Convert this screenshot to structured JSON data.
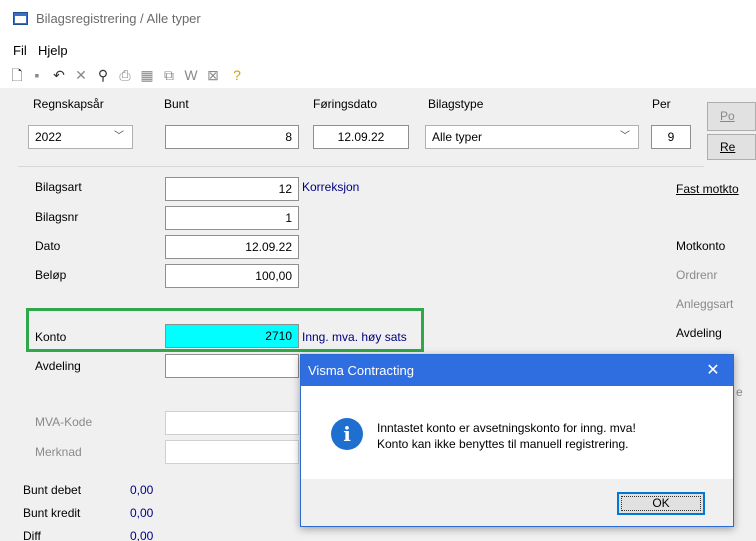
{
  "window": {
    "title": "Bilagsregistrering / Alle typer"
  },
  "menu": [
    "Fil",
    "Hjelp"
  ],
  "toolbar": {
    "icons": [
      "new-document-icon",
      "save-icon",
      "undo-icon",
      "delete-icon",
      "find-icon",
      "print-icon",
      "calculator-icon",
      "copy-icon",
      "word-icon",
      "excel-icon",
      "help-icon"
    ]
  },
  "header": {
    "regnskapsar_label": "Regnskapsår",
    "regnskapsar_value": "2022",
    "bunt_label": "Bunt",
    "bunt_value": "8",
    "foringsdato_label": "Føringsdato",
    "foringsdato_value": "12.09.22",
    "bilagstype_label": "Bilagstype",
    "bilagstype_value": "Alle typer",
    "per_label": "Per",
    "per_value": "9",
    "btn_top": "Po",
    "btn_bottom": "Re"
  },
  "form": {
    "bilagsart_label": "Bilagsart",
    "bilagsart_value": "12",
    "bilagsart_desc": "Korreksjon",
    "bilagsnr_label": "Bilagsnr",
    "bilagsnr_value": "1",
    "dato_label": "Dato",
    "dato_value": "12.09.22",
    "belop_label": "Beløp",
    "belop_value": "100,00",
    "konto_label": "Konto",
    "konto_value": "2710",
    "konto_desc": "Inng. mva. høy sats",
    "avdeling_label": "Avdeling",
    "mvakode_label": "MVA-Kode",
    "merknad_label": "Merknad"
  },
  "right_labels": {
    "fast_motkto": "Fast motkto",
    "motkonto": "Motkonto",
    "ordrenr": "Ordrenr",
    "anleggsart": "Anleggsart",
    "avdeling": "Avdeling",
    "partial": "e"
  },
  "totals": {
    "debet_label": "Bunt debet",
    "debet_value": "0,00",
    "kredit_label": "Bunt kredit",
    "kredit_value": "0,00",
    "diff_label": "Diff",
    "diff_value": "0,00"
  },
  "dialog": {
    "title": "Visma Contracting",
    "close": "✕",
    "line1": "Inntastet konto er avsetningskonto for inng. mva!",
    "line2": "Konto kan ikke benyttes til manuell registrering.",
    "ok": "OK"
  },
  "colors": {
    "highlight_field": "#00ffff",
    "highlight_border": "#2ea84a",
    "dialog_title": "#2f6ee0",
    "link_text": "#00007f"
  }
}
